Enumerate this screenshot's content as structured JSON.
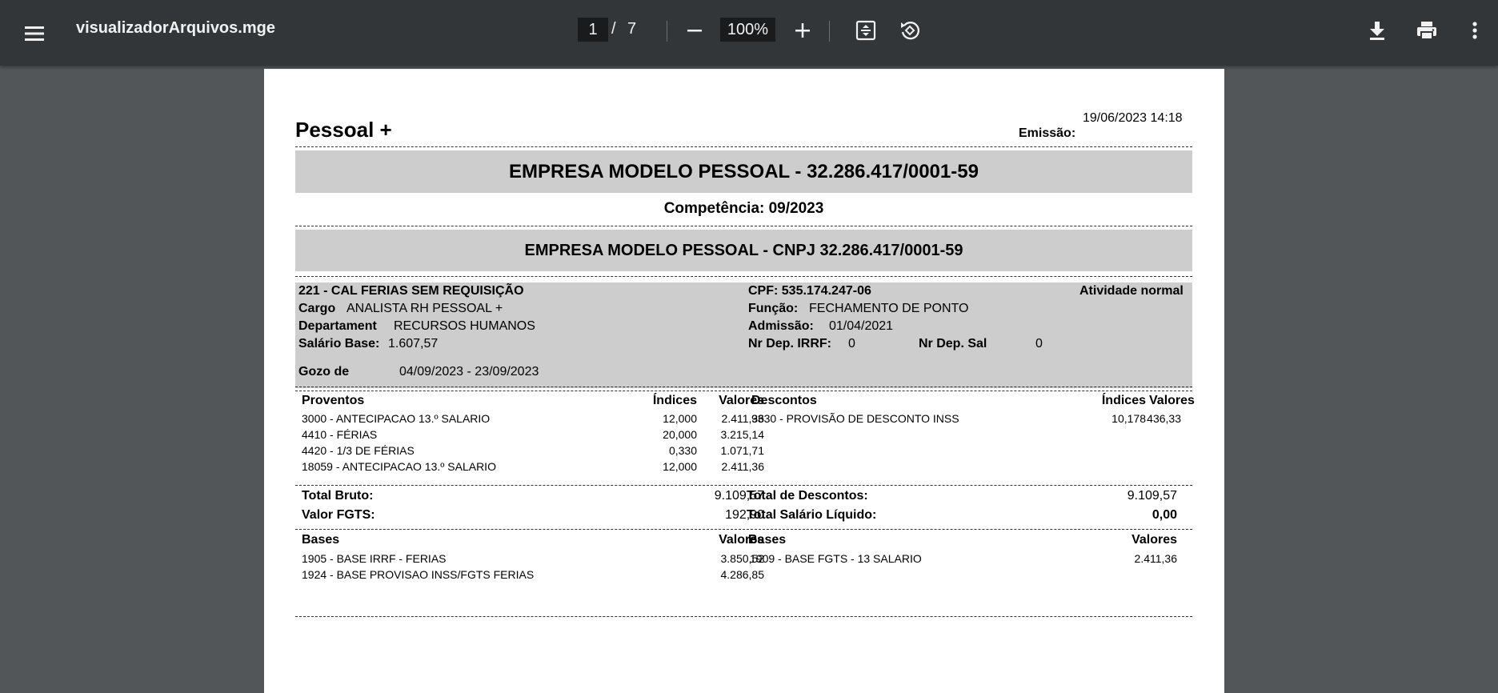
{
  "viewer": {
    "title": "visualizadorArquivos.mge",
    "page_current": "1",
    "page_separator": "/",
    "page_total": "7",
    "zoom": "100%",
    "icons": [
      "menu-icon",
      "minus-icon",
      "plus-icon",
      "fit-page-icon",
      "rotate-icon",
      "download-icon",
      "print-icon",
      "more-vert-icon"
    ]
  },
  "doc": {
    "brand": "Pessoal +",
    "emission_label": "Emissão:",
    "emission_value": "19/06/2023 14:18",
    "company_banner": "EMPRESA MODELO PESSOAL  - 32.286.417/0001-59",
    "competencia": "Competência: 09/2023",
    "company_cnpj": "EMPRESA MODELO PESSOAL  - CNPJ 32.286.417/0001-59",
    "employee": {
      "id_name": "221 -  CAL FERIAS SEM REQUISIÇÃO",
      "cargo_label": "Cargo",
      "cargo_value": "ANALISTA RH PESSOAL +",
      "dept_label": "Departament",
      "dept_value": "RECURSOS HUMANOS",
      "salario_label": "Salário Base:",
      "salario_value": "1.607,57",
      "gozo_label": "Gozo de",
      "gozo_value": "04/09/2023 - 23/09/2023",
      "cpf": "CPF: 535.174.247-06",
      "atividade": "Atividade normal",
      "funcao_label": "Função:",
      "funcao_value": "FECHAMENTO DE PONTO",
      "admissao_label": "Admissão:",
      "admissao_value": "01/04/2021",
      "irrf_label": "Nr Dep. IRRF:",
      "irrf_value": "0",
      "depsal_label": "Nr Dep. Sal",
      "depsal_value": "0"
    },
    "proventos": {
      "headers": [
        "Proventos",
        "Índices",
        "Valores"
      ],
      "rows": [
        [
          "3000 - ANTECIPACAO 13.º SALARIO",
          "12,000",
          "2.411,36"
        ],
        [
          "4410 - FÉRIAS",
          "20,000",
          "3.215,14"
        ],
        [
          "4420 - 1/3 DE FÉRIAS",
          "0,330",
          "1.071,71"
        ],
        [
          "18059 - ANTECIPACAO 13.º SALARIO",
          "12,000",
          "2.411,36"
        ]
      ]
    },
    "descontos": {
      "headers": [
        "Descontos",
        "Índices",
        "Valores"
      ],
      "rows": [
        [
          "9330 - PROVISÃO DE DESCONTO INSS",
          "10,178",
          "436,33"
        ]
      ]
    },
    "totals": {
      "bruto_label": "Total Bruto:",
      "bruto_value": "9.109,57",
      "fgts_label": "Valor FGTS:",
      "fgts_value": "192,90",
      "descontos_label": "Total de Descontos:",
      "descontos_value": "9.109,57",
      "liquido_label": "Total Salário Líquido:",
      "liquido_value": "0,00"
    },
    "bases_left": {
      "headers": [
        "Bases",
        "Valores"
      ],
      "rows": [
        [
          "1905 - BASE IRRF - FERIAS",
          "3.850,52"
        ],
        [
          "1924 - BASE PROVISAO INSS/FGTS FERIAS",
          "4.286,85"
        ]
      ]
    },
    "bases_right": {
      "headers": [
        "Bases",
        "Valores"
      ],
      "rows": [
        [
          "1909 - BASE FGTS - 13 SALARIO",
          "2.411,36"
        ]
      ]
    }
  }
}
